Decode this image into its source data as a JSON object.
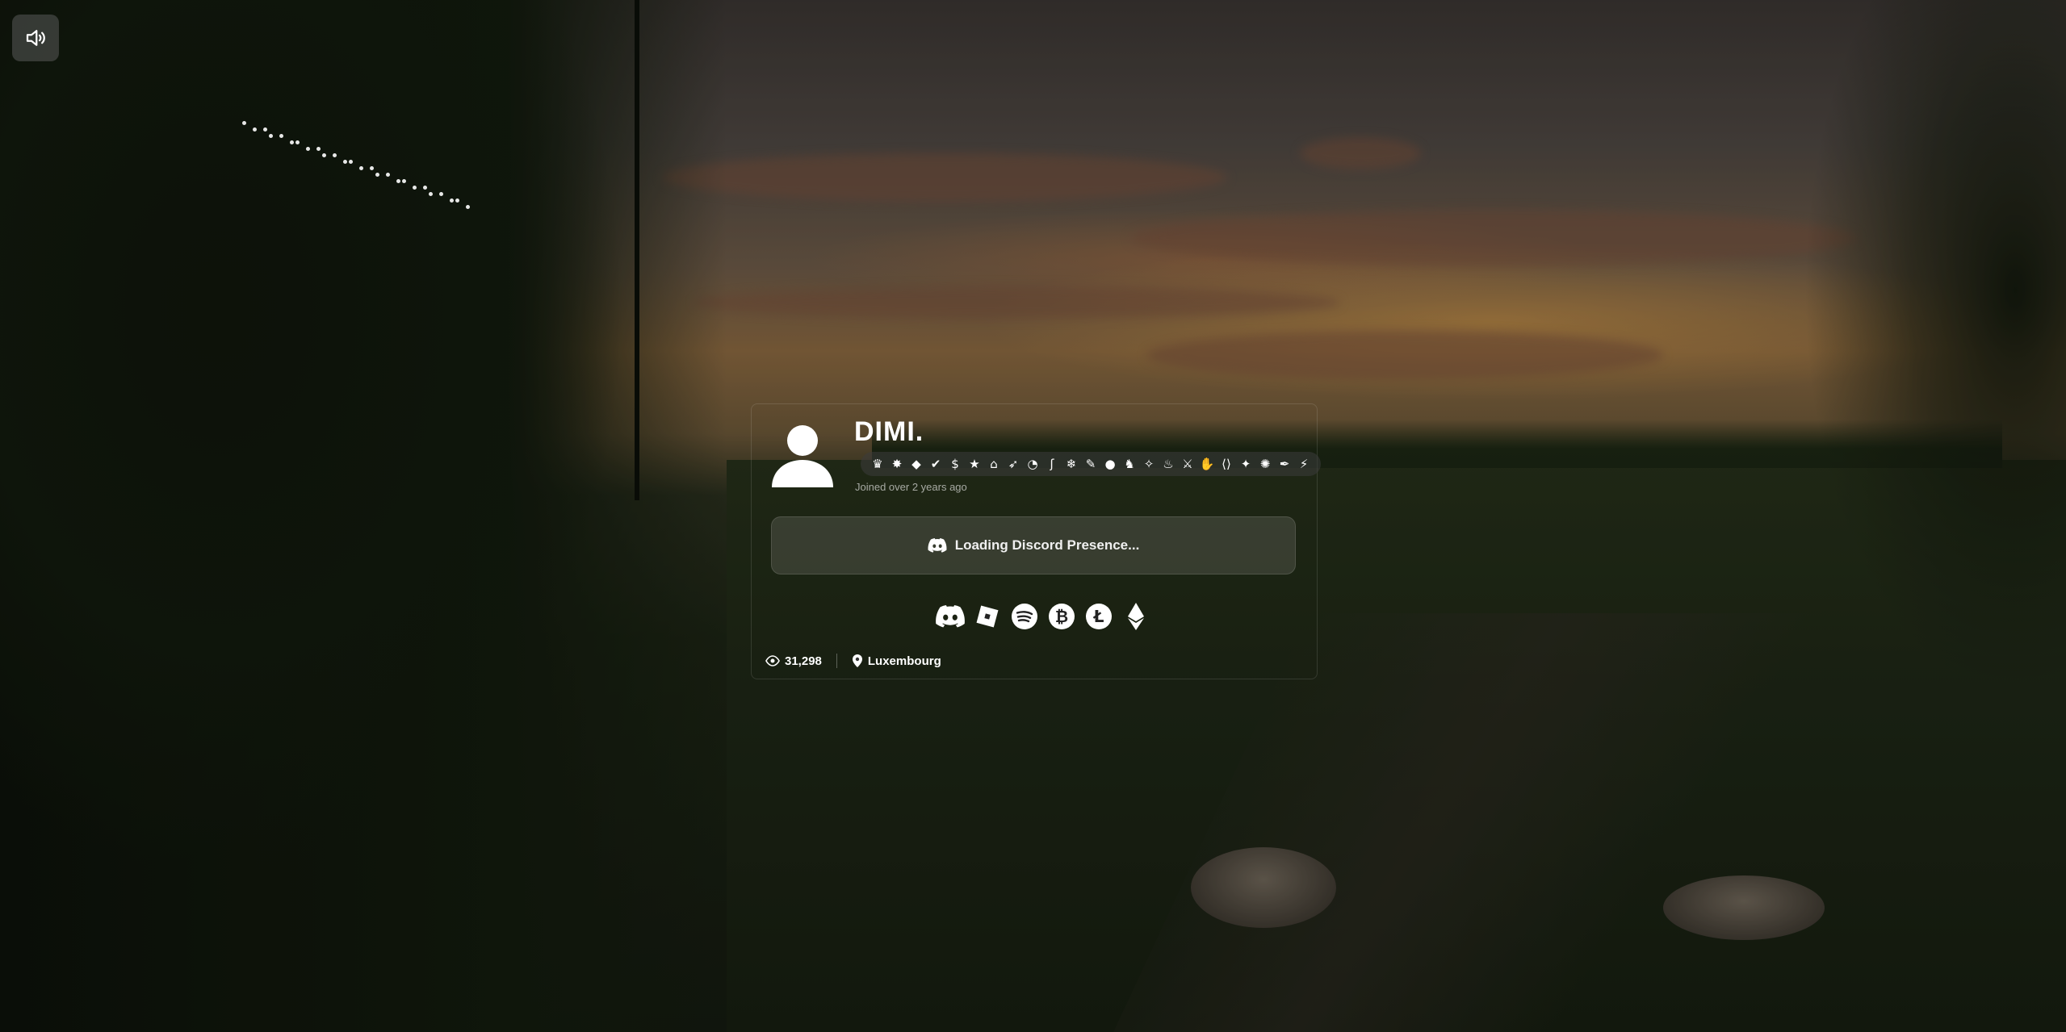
{
  "profile": {
    "username": "DIMI.",
    "joined": "Joined over 2 years ago"
  },
  "presence": {
    "text": "Loading Discord Presence..."
  },
  "badges": [
    "crown-icon",
    "bug-icon",
    "diamond-icon",
    "verified-icon",
    "coin-icon",
    "star-icon",
    "gift-icon",
    "rocket-icon",
    "speedometer-icon",
    "hook-icon",
    "snowflake-icon",
    "brush-icon",
    "egg-icon",
    "bunny-icon",
    "wand-icon",
    "flame-icon",
    "sword-icon",
    "hands-icon",
    "code-icon",
    "sparkle-icon",
    "magic-icon",
    "pen-icon",
    "bolt-icon"
  ],
  "socials": [
    "discord-icon",
    "roblox-icon",
    "spotify-icon",
    "bitcoin-icon",
    "litecoin-icon",
    "ethereum-icon"
  ],
  "stats": {
    "views": "31,298",
    "location": "Luxembourg"
  },
  "colors": {
    "text": "#ffffff",
    "muted": "#9a9a9a"
  }
}
